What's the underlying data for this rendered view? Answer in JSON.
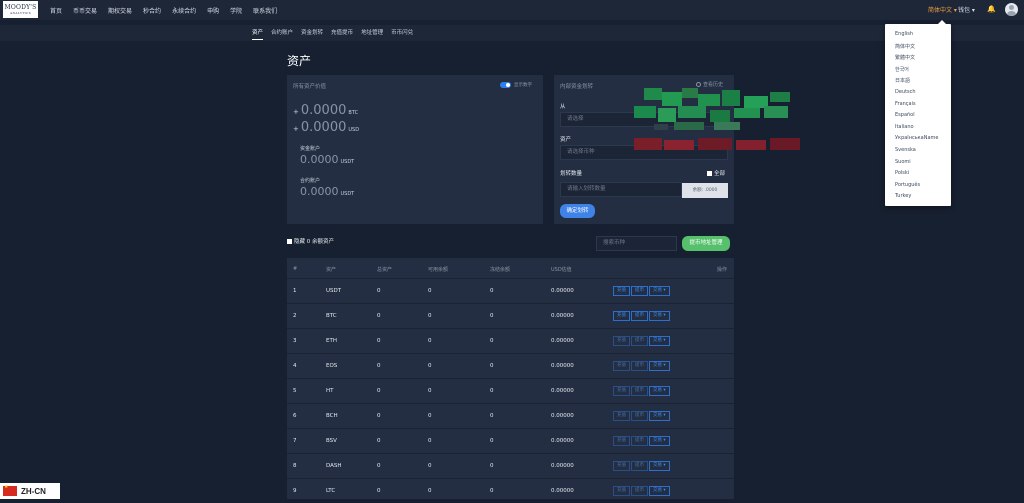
{
  "header": {
    "logo_line1": "MOODY'S",
    "logo_line2": "ANALYTICS",
    "nav": [
      "首页",
      "币币交易",
      "期权交易",
      "秒合约",
      "永续合约",
      "申购",
      "学院",
      "联系我们"
    ],
    "language_trigger": "简体中文 ▾",
    "wallet_trigger": "钱包 ▾",
    "bell_icon": "bell-icon",
    "avatar_icon": "user-avatar-icon"
  },
  "subnav": {
    "items": [
      "资产",
      "合约账户",
      "资金划转",
      "充值提币",
      "地址管理",
      "币币闪兑"
    ],
    "active": "资产"
  },
  "page": {
    "title": "资产"
  },
  "assets_card": {
    "title": "所有资产价值",
    "toggle_label": "显示数字",
    "btc_sign": "+",
    "btc_value": "0.0000",
    "btc_unit": "BTC",
    "usd_sign": "+",
    "usd_value": "0.0000",
    "usd_unit": "USD",
    "fund_label": "资金账户",
    "fund_value": "0.0000",
    "fund_unit": "USDT",
    "contract_label": "合约账户",
    "contract_value": "0.0000",
    "contract_unit": "USDT"
  },
  "transfer_card": {
    "title": "内部资金划转",
    "history": "查看历史",
    "from_label": "从",
    "from_placeholder": "请选择",
    "asset_label": "资产",
    "asset_placeholder": "请选择币种",
    "amount_label": "划转数量",
    "all_label": "全部",
    "amount_placeholder": "请输入划转数量",
    "available": "余额: .0000",
    "confirm": "确定划转"
  },
  "filters": {
    "hide_zero": "隐藏 0 余额资产",
    "search_placeholder": "搜索币种",
    "address_button": "提币地址管理"
  },
  "table": {
    "headers": [
      "#",
      "资产",
      "总资产",
      "可用余额",
      "冻结余额",
      "USD估值",
      "操作"
    ],
    "op_labels": [
      "充值",
      "提币",
      "交易 ▾"
    ],
    "rows": [
      {
        "n": "1",
        "asset": "USDT",
        "total": "0",
        "avail": "0",
        "frozen": "0",
        "usd": "0.00000"
      },
      {
        "n": "2",
        "asset": "BTC",
        "total": "0",
        "avail": "0",
        "frozen": "0",
        "usd": "0.00000"
      },
      {
        "n": "3",
        "asset": "ETH",
        "total": "0",
        "avail": "0",
        "frozen": "0",
        "usd": "0.00000"
      },
      {
        "n": "4",
        "asset": "EOS",
        "total": "0",
        "avail": "0",
        "frozen": "0",
        "usd": "0.00000"
      },
      {
        "n": "5",
        "asset": "HT",
        "total": "0",
        "avail": "0",
        "frozen": "0",
        "usd": "0.00000"
      },
      {
        "n": "6",
        "asset": "BCH",
        "total": "0",
        "avail": "0",
        "frozen": "0",
        "usd": "0.00000"
      },
      {
        "n": "7",
        "asset": "BSV",
        "total": "0",
        "avail": "0",
        "frozen": "0",
        "usd": "0.00000"
      },
      {
        "n": "8",
        "asset": "DASH",
        "total": "0",
        "avail": "0",
        "frozen": "0",
        "usd": "0.00000"
      },
      {
        "n": "9",
        "asset": "LTC",
        "total": "0",
        "avail": "0",
        "frozen": "0",
        "usd": "0.00000"
      }
    ]
  },
  "language_menu": {
    "items": [
      "English",
      "简体中文",
      "繁體中文",
      "한국어",
      "日本語",
      "Deutsch",
      "Français",
      "Español",
      "Italiano",
      "УкраїнськаName",
      "Svenska",
      "Suomi",
      "Polski",
      "Português",
      "Turkey"
    ]
  },
  "footer_badge": {
    "text": "ZH-CN"
  },
  "colors": {
    "page_bg": "#172030",
    "card_bg": "#232e42",
    "accent_blue": "#3f82e8",
    "accent_green": "#56c06c",
    "lang_orange": "#f0a040"
  }
}
